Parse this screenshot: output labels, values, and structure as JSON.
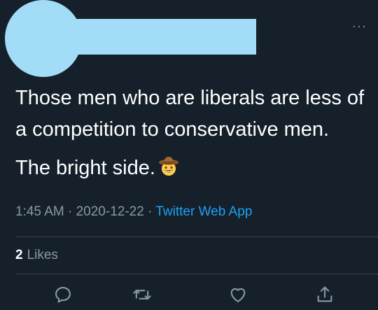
{
  "tweet": {
    "line1": "Those men who are liberals are less of a competition to conservative men.",
    "line2": "The bright side.",
    "emoji": "cowboy-hat-face-emoji"
  },
  "meta": {
    "time": "1:45 AM",
    "sep1": " · ",
    "date": "2020-12-22",
    "sep2": " · ",
    "source": "Twitter Web App"
  },
  "likes": {
    "count": "2",
    "label": "Likes"
  },
  "more_label": "···",
  "actions": [
    "reply-icon",
    "retweet-icon",
    "like-icon",
    "share-icon"
  ],
  "colors": {
    "background": "#15202b",
    "accent": "#1da1f2",
    "muted": "#8899a6",
    "redaction": "#a3dcf6"
  }
}
